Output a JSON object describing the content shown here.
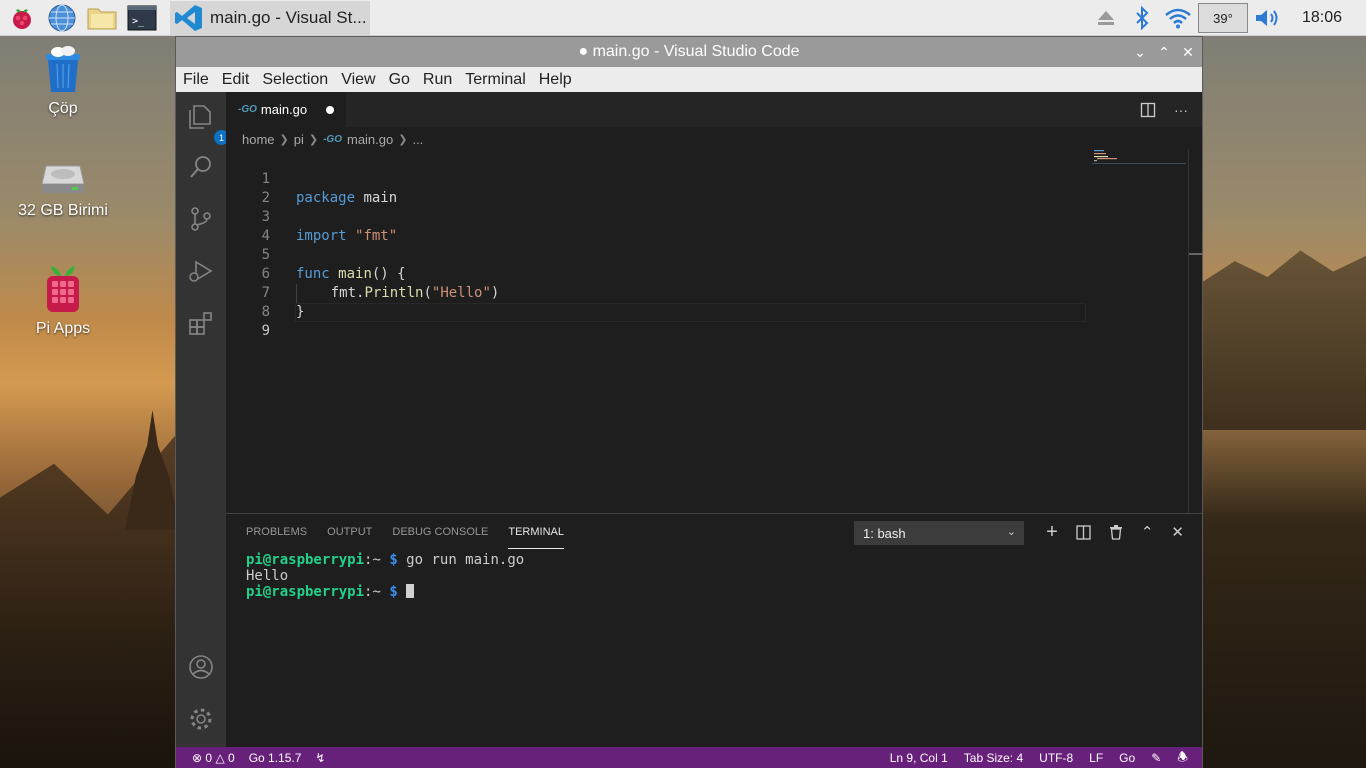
{
  "taskbar": {
    "active_task": "main.go - Visual St...",
    "temperature": "39°",
    "clock": "18:06"
  },
  "desktop": {
    "icons": [
      {
        "label": "Çöp",
        "icon": "trash-icon"
      },
      {
        "label": "32 GB Birimi",
        "icon": "drive-icon"
      },
      {
        "label": "Pi Apps",
        "icon": "raspberry-icon"
      }
    ]
  },
  "window": {
    "title": "● main.go - Visual Studio Code",
    "menu": [
      "File",
      "Edit",
      "Selection",
      "View",
      "Go",
      "Run",
      "Terminal",
      "Help"
    ]
  },
  "activity_bar": {
    "explorer_badge": "1"
  },
  "editor": {
    "tab": {
      "go_badge": "-GO",
      "label": "main.go"
    },
    "breadcrumb": [
      "home",
      "pi",
      "main.go",
      "..."
    ],
    "breadcrumb_go_badge": "-GO",
    "lines": [
      {
        "n": "1"
      },
      {
        "n": "2"
      },
      {
        "n": "3"
      },
      {
        "n": "4"
      },
      {
        "n": "5"
      },
      {
        "n": "6"
      },
      {
        "n": "7"
      },
      {
        "n": "8"
      },
      {
        "n": "9"
      }
    ],
    "code": {
      "l1_kw": "package",
      "l1_rest": " main",
      "l3_kw": "import",
      "l3_str": "\"fmt\"",
      "l5_kw": "func",
      "l5_fn": "main",
      "l5_rest": "() {",
      "l6_pre": "    fmt.",
      "l6_fn": "Println",
      "l6_open": "(",
      "l6_str": "\"Hello\"",
      "l6_close": ")",
      "l7": "}"
    },
    "active_line": "9"
  },
  "panel": {
    "tabs": [
      "PROBLEMS",
      "OUTPUT",
      "DEBUG CONSOLE",
      "TERMINAL"
    ],
    "terminal_select": "1: bash",
    "terminal": {
      "prompt1": "pi@raspberrypi",
      "sep1": ":~ ",
      "dollar1": "$",
      "cmd1": " go run main.go",
      "output": "Hello",
      "prompt2": "pi@raspberrypi",
      "sep2": ":~ ",
      "dollar2": "$"
    }
  },
  "statusbar": {
    "errors": "0",
    "warnings": "0",
    "go_version": "Go 1.15.7",
    "position": "Ln 9, Col 1",
    "tab_size": "Tab Size: 4",
    "encoding": "UTF-8",
    "eol": "LF",
    "language": "Go"
  },
  "colors": {
    "statusbar": "#68217a",
    "activity_bar": "#333333",
    "editor_bg": "#1e1e1e",
    "keyword": "#569cd6",
    "string": "#ce9178",
    "function": "#dcdcaa",
    "prompt": "#23d18b"
  }
}
